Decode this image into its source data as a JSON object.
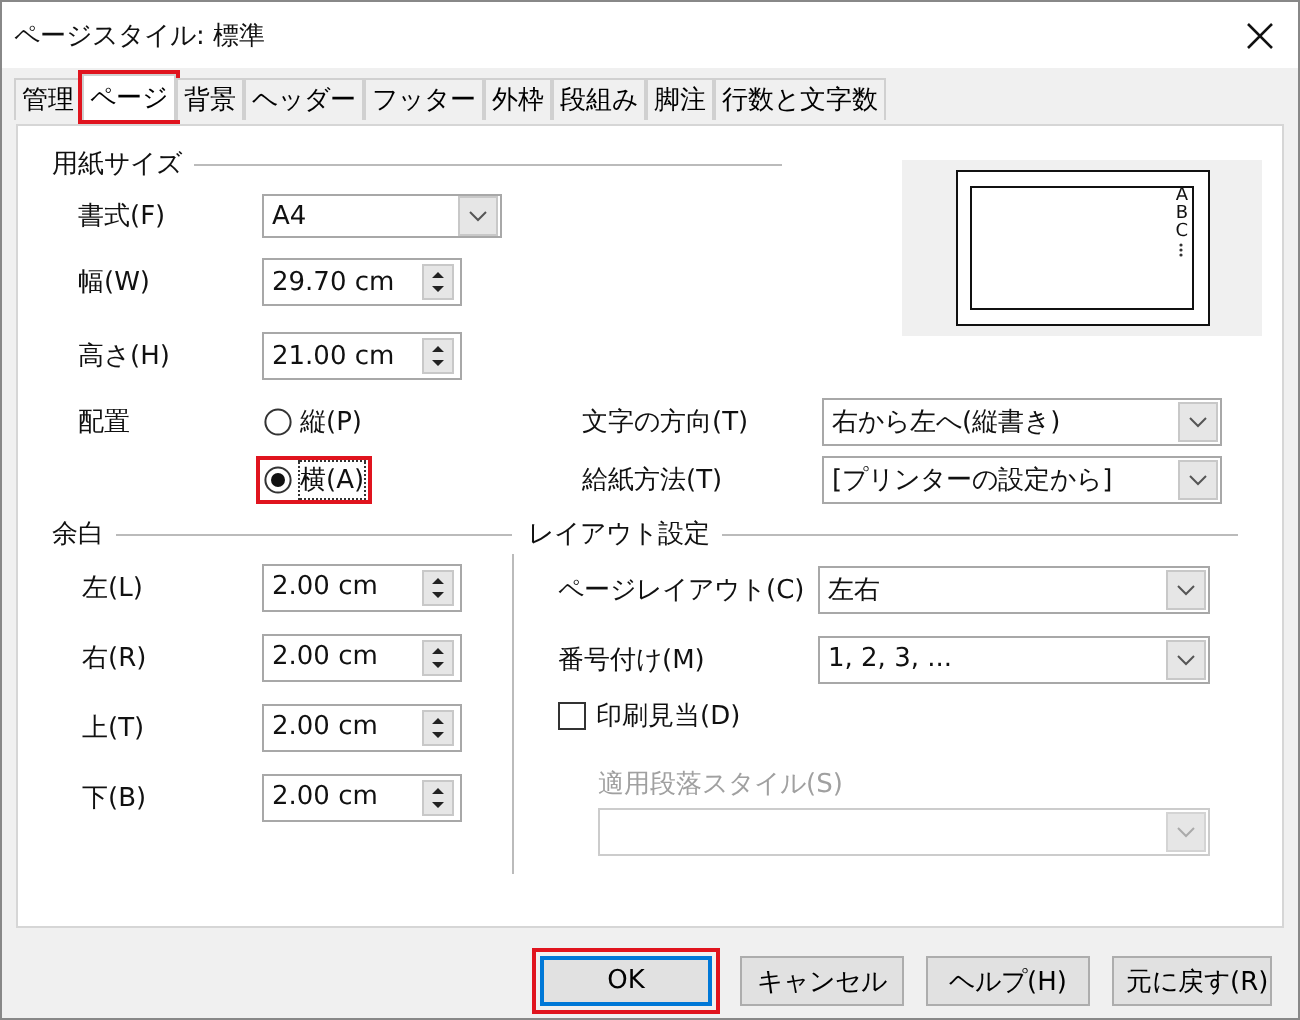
{
  "window": {
    "title": "ページスタイル: 標準"
  },
  "tabs": [
    {
      "label": "管理",
      "selected": false,
      "highlighted": false
    },
    {
      "label": "ページ",
      "selected": true,
      "highlighted": true
    },
    {
      "label": "背景",
      "selected": false,
      "highlighted": false
    },
    {
      "label": "ヘッダー",
      "selected": false,
      "highlighted": false
    },
    {
      "label": "フッター",
      "selected": false,
      "highlighted": false
    },
    {
      "label": "外枠",
      "selected": false,
      "highlighted": false
    },
    {
      "label": "段組み",
      "selected": false,
      "highlighted": false
    },
    {
      "label": "脚注",
      "selected": false,
      "highlighted": false
    },
    {
      "label": "行数と文字数",
      "selected": false,
      "highlighted": false
    }
  ],
  "paper_size": {
    "heading": "用紙サイズ",
    "format": {
      "label": "書式(F)",
      "value": "A4"
    },
    "width": {
      "label": "幅(W)",
      "value": "29.70 cm"
    },
    "height": {
      "label": "高さ(H)",
      "value": "21.00 cm"
    },
    "orientation": {
      "label": "配置",
      "options": [
        {
          "label": "縦(P)",
          "selected": false,
          "highlighted": false
        },
        {
          "label": "横(A)",
          "selected": true,
          "highlighted": true
        }
      ]
    },
    "text_direction": {
      "label": "文字の方向(T)",
      "value": "右から左へ(縦書き)"
    },
    "paper_tray": {
      "label": "給紙方法(T)",
      "value": "[プリンターの設定から]"
    }
  },
  "preview": {
    "letters": [
      "A",
      "B",
      "C"
    ]
  },
  "margins": {
    "heading": "余白",
    "fields": [
      {
        "label": "左(L)",
        "value": "2.00 cm"
      },
      {
        "label": "右(R)",
        "value": "2.00 cm"
      },
      {
        "label": "上(T)",
        "value": "2.00 cm"
      },
      {
        "label": "下(B)",
        "value": "2.00 cm"
      }
    ]
  },
  "layout": {
    "heading": "レイアウト設定",
    "page_layout": {
      "label": "ページレイアウト(C)",
      "value": "左右"
    },
    "numbering": {
      "label": "番号付け(M)",
      "value": "1, 2, 3, ..."
    },
    "register_true": {
      "label": "印刷見当(D)",
      "checked": false
    },
    "reference_style": {
      "label": "適用段落スタイル(S)",
      "disabled": true
    }
  },
  "buttons": [
    {
      "label": "OK",
      "default": true,
      "highlighted": true
    },
    {
      "label": "キャンセル",
      "default": false,
      "highlighted": false
    },
    {
      "label": "ヘルプ(H)",
      "default": false,
      "highlighted": false
    },
    {
      "label": "元に戻す(R)",
      "default": false,
      "highlighted": false
    }
  ]
}
